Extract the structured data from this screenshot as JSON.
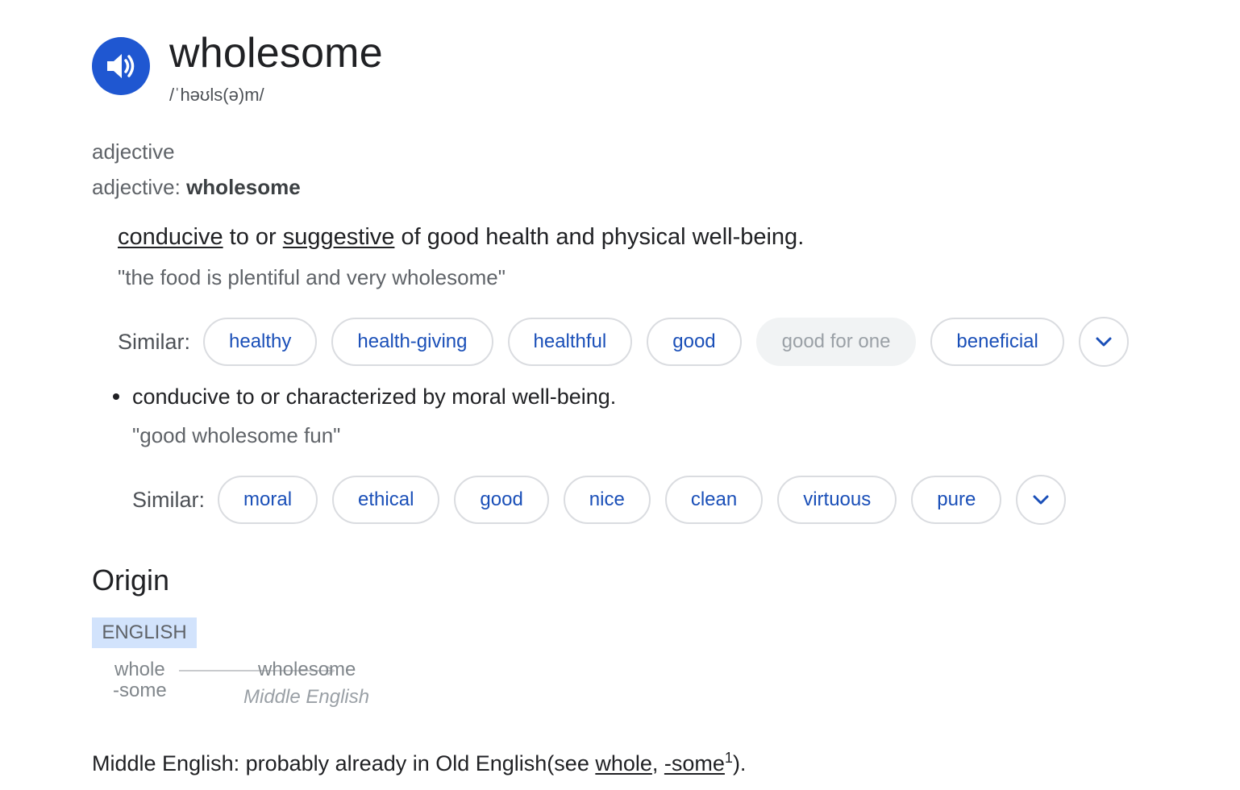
{
  "entry": {
    "word": "wholesome",
    "phonetic": "/ˈhəʊls(ə)m/",
    "audio_icon": "speaker-icon"
  },
  "part_of_speech": {
    "label": "adjective",
    "line_prefix": "adjective",
    "line_separator": ": ",
    "line_word": "wholesome"
  },
  "sense1": {
    "def_parts": [
      "conducive",
      " to or ",
      "suggestive",
      " of good health and physical well-being."
    ],
    "example": "\"the food is plentiful and very wholesome\"",
    "similar_label": "Similar:",
    "similar": [
      "healthy",
      "health-giving",
      "healthful",
      "good",
      "good for one",
      "beneficial"
    ],
    "disabled_chip": "good for one",
    "expand_icon": "chevron-down-icon"
  },
  "sense2": {
    "definition": "conducive to or characterized by moral well-being.",
    "example": "\"good wholesome fun\"",
    "similar_label": "Similar:",
    "similar": [
      "moral",
      "ethical",
      "good",
      "nice",
      "clean",
      "virtuous",
      "pure"
    ],
    "expand_icon": "chevron-down-icon"
  },
  "origin": {
    "title": "Origin",
    "language": "ENGLISH",
    "sources": [
      "whole",
      "-some"
    ],
    "result": "wholesome",
    "result_lang": "Middle English",
    "note_prefix": "Middle English: probably already in Old English(see ",
    "link1": "whole",
    "sep": ", ",
    "link2": "-some",
    "sup": "1",
    "note_suffix": ")."
  },
  "colors": {
    "audio_button": "#1f57d1",
    "chip_text": "#1a4fb8",
    "chip_border": "#dadce0",
    "lang_bg": "#d2e3fc"
  }
}
